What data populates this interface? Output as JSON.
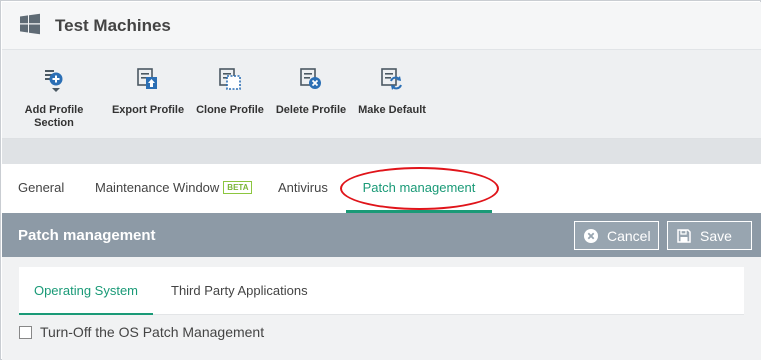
{
  "header": {
    "title": "Test Machines",
    "icon": "windows-logo-icon"
  },
  "toolbar": {
    "items": [
      {
        "label_line1": "Add Profile",
        "label_line2": "Section",
        "icon": "add-section-icon"
      },
      {
        "label": "Export Profile",
        "icon": "export-icon"
      },
      {
        "label": "Clone Profile",
        "icon": "clone-icon"
      },
      {
        "label": "Delete Profile",
        "icon": "delete-icon"
      },
      {
        "label": "Make Default",
        "icon": "make-default-icon"
      }
    ]
  },
  "tabs": {
    "items": [
      {
        "label": "General"
      },
      {
        "label": "Maintenance Window",
        "badge": "BETA"
      },
      {
        "label": "Antivirus"
      },
      {
        "label": "Patch management",
        "active": true
      }
    ]
  },
  "section": {
    "title": "Patch management",
    "cancel_label": "Cancel",
    "save_label": "Save"
  },
  "subtabs": {
    "items": [
      {
        "label": "Operating System",
        "active": true
      },
      {
        "label": "Third Party Applications"
      }
    ]
  },
  "options": {
    "turn_off_label": "Turn-Off the OS Patch Management",
    "turn_off_checked": false
  },
  "colors": {
    "accent": "#1a9a77",
    "section_bar": "#8d9aa6",
    "highlight": "#e0141a",
    "beta": "#8cc63f"
  }
}
